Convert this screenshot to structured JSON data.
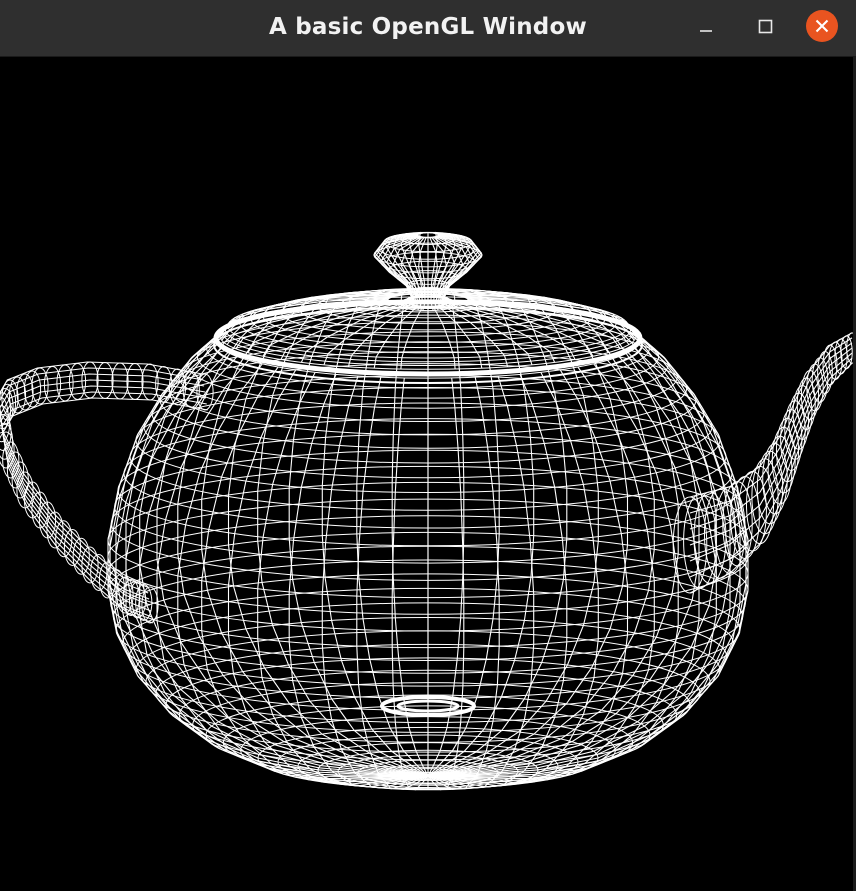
{
  "window": {
    "title": "A basic OpenGL Window",
    "controls": {
      "minimize": "minimize-icon",
      "maximize": "maximize-icon",
      "close": "close-icon"
    }
  },
  "scene": {
    "object": "teapot-wireframe",
    "background_color": "#000000",
    "wire_color": "#ffffff"
  },
  "colors": {
    "titlebar": "#2f2f2f",
    "close_button": "#e95420"
  }
}
